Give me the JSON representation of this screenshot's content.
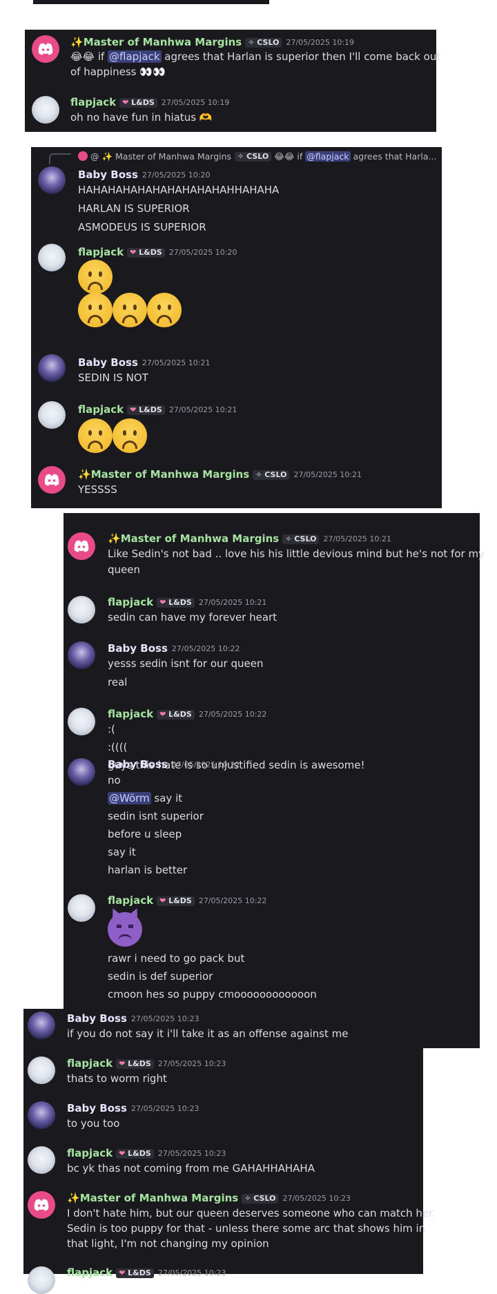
{
  "users": {
    "master": {
      "name": "Master of Manhwa Margins",
      "tag": "CSLO"
    },
    "flap": {
      "name": "flapjack",
      "tag": "L&DS"
    },
    "boss": {
      "name": "Baby Boss"
    }
  },
  "panel1": {
    "m1": {
      "time": "27/05/2025 10:19",
      "pre": "😂😂 if ",
      "mention": "@flapjack",
      "post": " agrees that Harlan is superior then I'll come back out",
      "line2": "of happiness 👀👀"
    },
    "m2": {
      "time": "27/05/2025 10:19",
      "text": "oh no have fun in hiatus 🫶"
    }
  },
  "panel2": {
    "reply": {
      "prefix": "@ ✨ Master of Manhwa Margins",
      "tag": "CSLO",
      "pre": "😂😂 if ",
      "mention": "@flapjack",
      "post": " agrees that Harla..."
    },
    "m1": {
      "time": "27/05/2025 10:20",
      "lines": [
        "HAHAHAHAHAHAHAHAHAHAHHAHAHA",
        "HARLAN IS SUPERIOR",
        "ASMODEUS IS SUPERIOR"
      ]
    },
    "m2": {
      "time": "27/05/2025 10:20"
    },
    "m3": {
      "time": "27/05/2025 10:21",
      "text": "SEDIN IS NOT"
    },
    "m4": {
      "time": "27/05/2025 10:21"
    },
    "m5": {
      "time": "27/05/2025 10:21",
      "text": "YESSSS"
    }
  },
  "panel3": {
    "m1": {
      "time": "27/05/2025 10:21",
      "lines": [
        "Like Sedin's not bad .. love his his little devious mind but he's not for my",
        "queen"
      ]
    },
    "m2": {
      "time": "27/05/2025 10:21",
      "text": "sedin can have my forever heart"
    },
    "m3": {
      "time": "27/05/2025 10:22",
      "lines": [
        "yesss sedin isnt for our queen",
        "real"
      ]
    },
    "m4": {
      "time": "27/05/2025 10:22",
      "lines": [
        ":(",
        ":((((",
        "guys this hate is so unjustified sedin is awesome!"
      ]
    },
    "m5": {
      "time": "27/05/2025 10:22",
      "line1": "no",
      "mention": "@Wörm",
      "mention_post": " say it",
      "lines": [
        "sedin isnt superior",
        "before u sleep",
        "say it",
        "harlan is better"
      ]
    },
    "m6": {
      "time": "27/05/2025 10:22",
      "lines": [
        "rawr i need to go pack but",
        "sedin is def superior",
        "cmoon hes so puppy cmoooooooooooon"
      ]
    }
  },
  "panel4": {
    "m1": {
      "time": "27/05/2025 10:23",
      "text": "if you do not say it i'll take it as an offense against me"
    },
    "m2": {
      "time": "27/05/2025 10:23",
      "text": "thats to worm right"
    },
    "m3": {
      "time": "27/05/2025 10:23",
      "text": "to you too"
    },
    "m4": {
      "time": "27/05/2025 10:23",
      "text": "bc yk thas not coming from me GAHAHHAHAHA"
    },
    "m5": {
      "time": "27/05/2025 10:23",
      "lines": [
        "I don't hate him, but our queen deserves someone who can match her.",
        "Sedin is too puppy for that  - unless there some arc that shows him in",
        "that light, I'm not changing my opinion"
      ]
    },
    "m6": {
      "time": "27/05/2025 10:23"
    }
  }
}
